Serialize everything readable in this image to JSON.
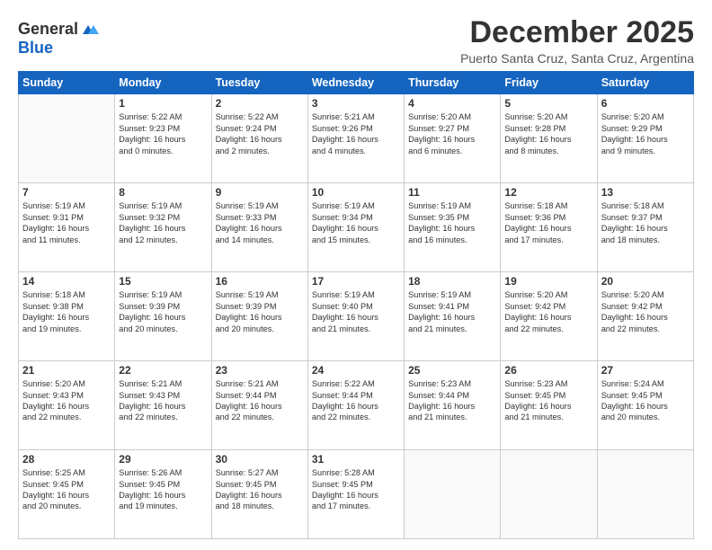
{
  "logo": {
    "line1": "General",
    "line2": "Blue"
  },
  "title": "December 2025",
  "subtitle": "Puerto Santa Cruz, Santa Cruz, Argentina",
  "header_days": [
    "Sunday",
    "Monday",
    "Tuesday",
    "Wednesday",
    "Thursday",
    "Friday",
    "Saturday"
  ],
  "weeks": [
    [
      {
        "day": "",
        "content": ""
      },
      {
        "day": "1",
        "content": "Sunrise: 5:22 AM\nSunset: 9:23 PM\nDaylight: 16 hours\nand 0 minutes."
      },
      {
        "day": "2",
        "content": "Sunrise: 5:22 AM\nSunset: 9:24 PM\nDaylight: 16 hours\nand 2 minutes."
      },
      {
        "day": "3",
        "content": "Sunrise: 5:21 AM\nSunset: 9:26 PM\nDaylight: 16 hours\nand 4 minutes."
      },
      {
        "day": "4",
        "content": "Sunrise: 5:20 AM\nSunset: 9:27 PM\nDaylight: 16 hours\nand 6 minutes."
      },
      {
        "day": "5",
        "content": "Sunrise: 5:20 AM\nSunset: 9:28 PM\nDaylight: 16 hours\nand 8 minutes."
      },
      {
        "day": "6",
        "content": "Sunrise: 5:20 AM\nSunset: 9:29 PM\nDaylight: 16 hours\nand 9 minutes."
      }
    ],
    [
      {
        "day": "7",
        "content": "Sunrise: 5:19 AM\nSunset: 9:31 PM\nDaylight: 16 hours\nand 11 minutes."
      },
      {
        "day": "8",
        "content": "Sunrise: 5:19 AM\nSunset: 9:32 PM\nDaylight: 16 hours\nand 12 minutes."
      },
      {
        "day": "9",
        "content": "Sunrise: 5:19 AM\nSunset: 9:33 PM\nDaylight: 16 hours\nand 14 minutes."
      },
      {
        "day": "10",
        "content": "Sunrise: 5:19 AM\nSunset: 9:34 PM\nDaylight: 16 hours\nand 15 minutes."
      },
      {
        "day": "11",
        "content": "Sunrise: 5:19 AM\nSunset: 9:35 PM\nDaylight: 16 hours\nand 16 minutes."
      },
      {
        "day": "12",
        "content": "Sunrise: 5:18 AM\nSunset: 9:36 PM\nDaylight: 16 hours\nand 17 minutes."
      },
      {
        "day": "13",
        "content": "Sunrise: 5:18 AM\nSunset: 9:37 PM\nDaylight: 16 hours\nand 18 minutes."
      }
    ],
    [
      {
        "day": "14",
        "content": "Sunrise: 5:18 AM\nSunset: 9:38 PM\nDaylight: 16 hours\nand 19 minutes."
      },
      {
        "day": "15",
        "content": "Sunrise: 5:19 AM\nSunset: 9:39 PM\nDaylight: 16 hours\nand 20 minutes."
      },
      {
        "day": "16",
        "content": "Sunrise: 5:19 AM\nSunset: 9:39 PM\nDaylight: 16 hours\nand 20 minutes."
      },
      {
        "day": "17",
        "content": "Sunrise: 5:19 AM\nSunset: 9:40 PM\nDaylight: 16 hours\nand 21 minutes."
      },
      {
        "day": "18",
        "content": "Sunrise: 5:19 AM\nSunset: 9:41 PM\nDaylight: 16 hours\nand 21 minutes."
      },
      {
        "day": "19",
        "content": "Sunrise: 5:20 AM\nSunset: 9:42 PM\nDaylight: 16 hours\nand 22 minutes."
      },
      {
        "day": "20",
        "content": "Sunrise: 5:20 AM\nSunset: 9:42 PM\nDaylight: 16 hours\nand 22 minutes."
      }
    ],
    [
      {
        "day": "21",
        "content": "Sunrise: 5:20 AM\nSunset: 9:43 PM\nDaylight: 16 hours\nand 22 minutes."
      },
      {
        "day": "22",
        "content": "Sunrise: 5:21 AM\nSunset: 9:43 PM\nDaylight: 16 hours\nand 22 minutes."
      },
      {
        "day": "23",
        "content": "Sunrise: 5:21 AM\nSunset: 9:44 PM\nDaylight: 16 hours\nand 22 minutes."
      },
      {
        "day": "24",
        "content": "Sunrise: 5:22 AM\nSunset: 9:44 PM\nDaylight: 16 hours\nand 22 minutes."
      },
      {
        "day": "25",
        "content": "Sunrise: 5:23 AM\nSunset: 9:44 PM\nDaylight: 16 hours\nand 21 minutes."
      },
      {
        "day": "26",
        "content": "Sunrise: 5:23 AM\nSunset: 9:45 PM\nDaylight: 16 hours\nand 21 minutes."
      },
      {
        "day": "27",
        "content": "Sunrise: 5:24 AM\nSunset: 9:45 PM\nDaylight: 16 hours\nand 20 minutes."
      }
    ],
    [
      {
        "day": "28",
        "content": "Sunrise: 5:25 AM\nSunset: 9:45 PM\nDaylight: 16 hours\nand 20 minutes."
      },
      {
        "day": "29",
        "content": "Sunrise: 5:26 AM\nSunset: 9:45 PM\nDaylight: 16 hours\nand 19 minutes."
      },
      {
        "day": "30",
        "content": "Sunrise: 5:27 AM\nSunset: 9:45 PM\nDaylight: 16 hours\nand 18 minutes."
      },
      {
        "day": "31",
        "content": "Sunrise: 5:28 AM\nSunset: 9:45 PM\nDaylight: 16 hours\nand 17 minutes."
      },
      {
        "day": "",
        "content": ""
      },
      {
        "day": "",
        "content": ""
      },
      {
        "day": "",
        "content": ""
      }
    ]
  ]
}
